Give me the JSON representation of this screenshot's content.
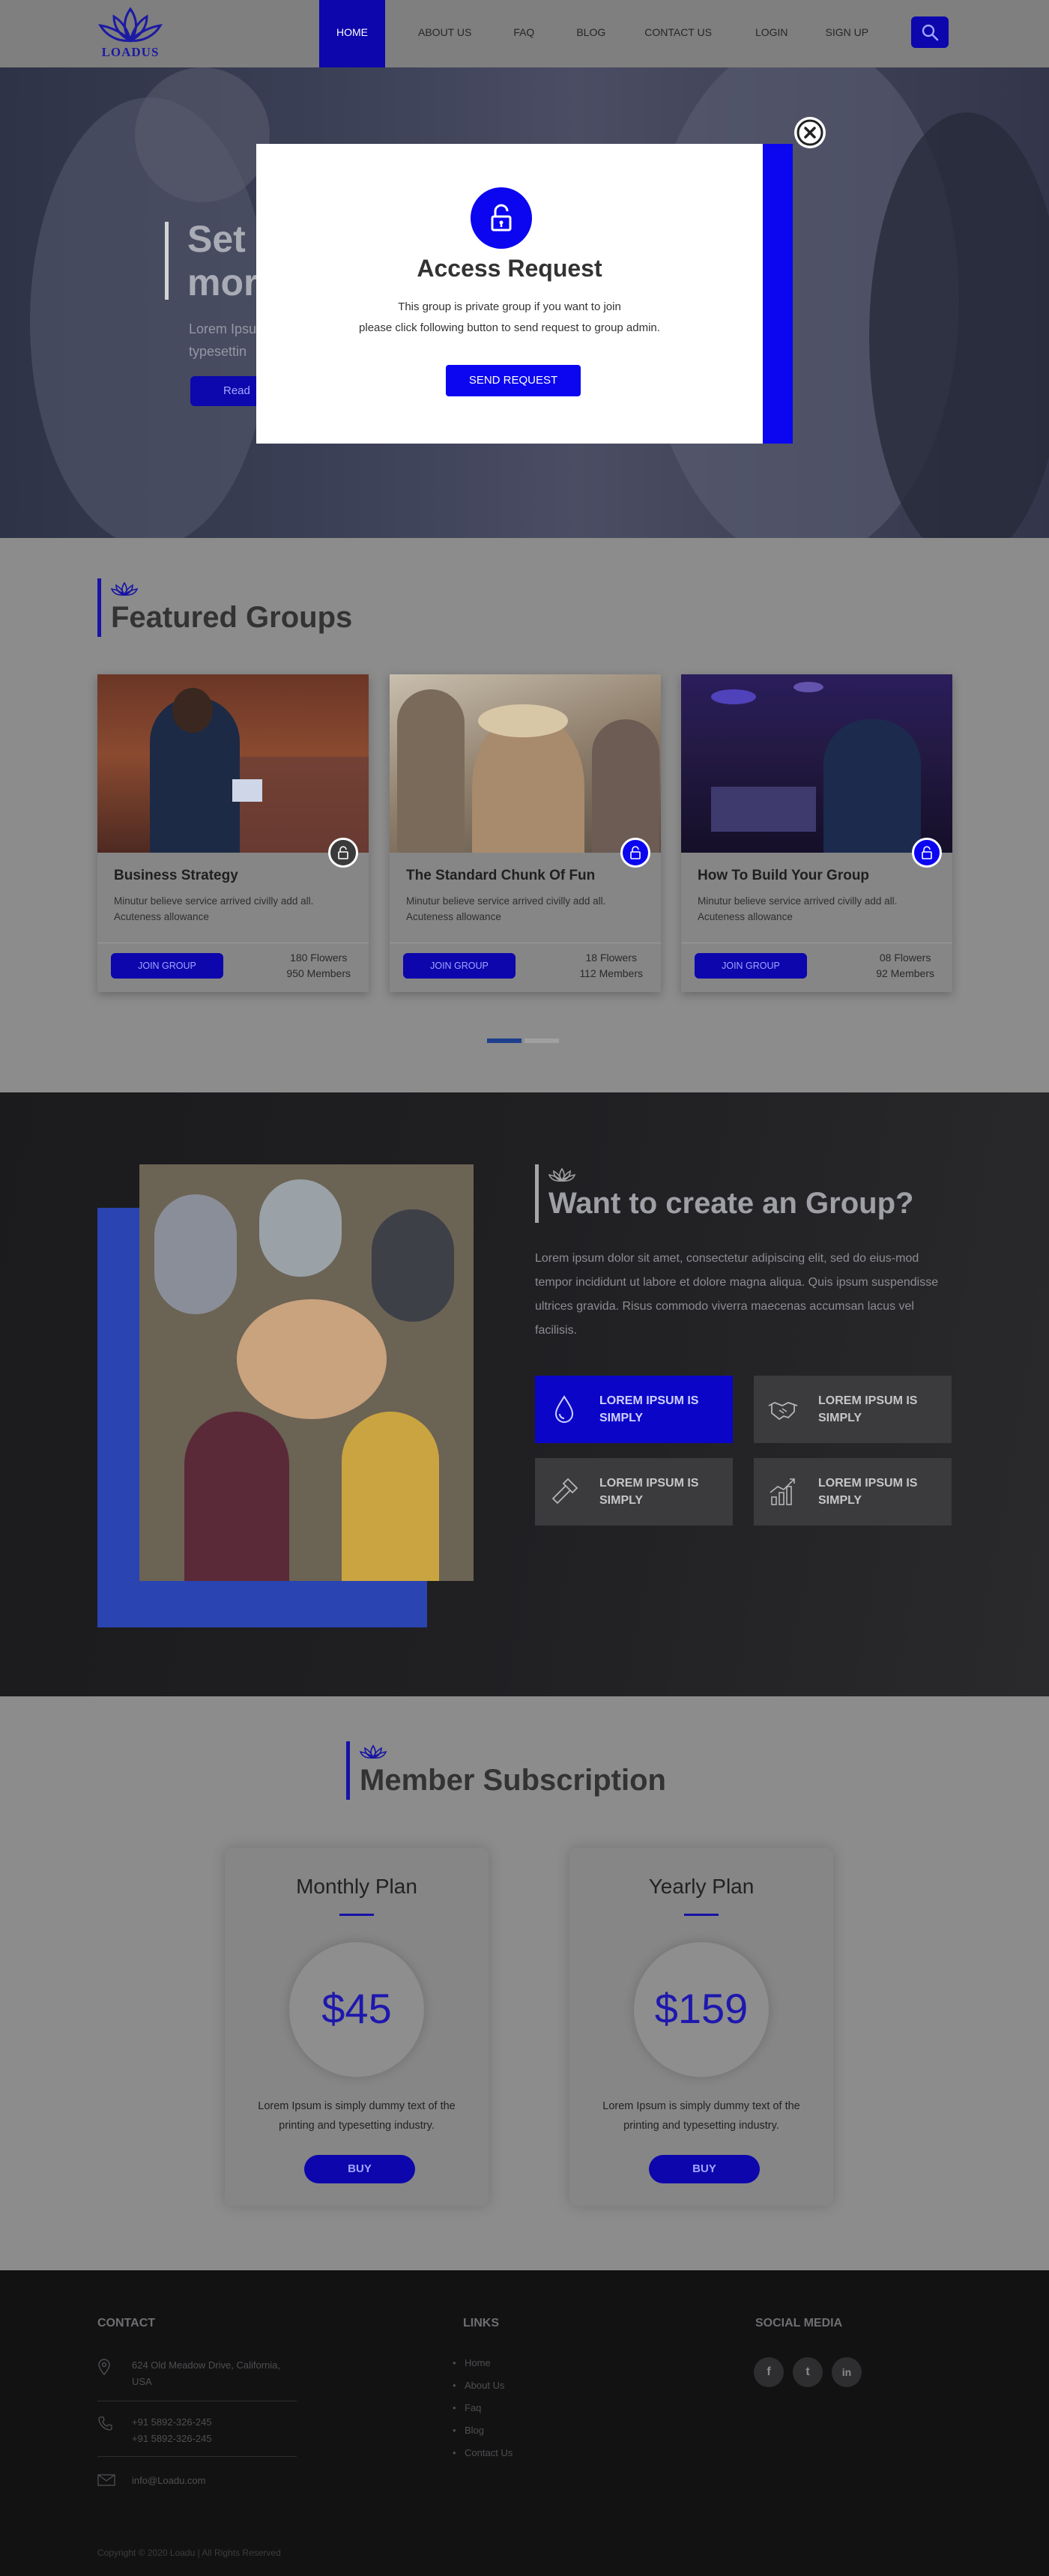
{
  "header": {
    "logo_text": "LOADUS",
    "nav": [
      "HOME",
      "ABOUT US",
      "FAQ",
      "BLOG",
      "CONTACT US",
      "LOGIN",
      "SIGN UP"
    ],
    "active_nav": "HOME",
    "search_icon": "search-icon"
  },
  "hero": {
    "title_line1": "Set",
    "title_line2": "mor",
    "subtitle_line1": "Lorem Ipsu",
    "subtitle_line2": "typesettin",
    "button_label": "Read"
  },
  "modal": {
    "title": "Access Request",
    "text_line1": "This group is private group if you want to join",
    "text_line2": "please click following button to send request to group admin.",
    "button_label": "SEND REQUEST",
    "icon": "unlock-icon",
    "close_icon": "close-icon"
  },
  "featured": {
    "title": "Featured Groups",
    "groups": [
      {
        "title": "Business Strategy",
        "desc": "Minutur believe service arrived civilly add all. Acuteness allowance",
        "button": "JOIN GROUP",
        "stat1": "180 Flowers",
        "stat2": "950 Members"
      },
      {
        "title": "The Standard Chunk Of Fun",
        "desc": "Minutur believe service arrived civilly add all. Acuteness allowance",
        "button": "JOIN GROUP",
        "stat1": "18 Flowers",
        "stat2": "112 Members"
      },
      {
        "title": "How To Build Your Group",
        "desc": "Minutur believe service arrived civilly add all. Acuteness allowance",
        "button": "JOIN GROUP",
        "stat1": "08 Flowers",
        "stat2": "92 Members"
      }
    ]
  },
  "create": {
    "title": "Want to create an Group?",
    "text": "Lorem ipsum dolor sit amet, consectetur adipiscing elit, sed do eius-mod tempor incididunt ut labore et dolore magna aliqua. Quis ipsum suspendisse ultrices gravida. Risus commodo viverra maecenas accumsan lacus vel facilisis.",
    "features": [
      {
        "label": "LOREM IPSUM IS SIMPLY",
        "icon": "water-drop-icon"
      },
      {
        "label": "LOREM IPSUM IS SIMPLY",
        "icon": "handshake-icon"
      },
      {
        "label": "LOREM IPSUM IS SIMPLY",
        "icon": "hammer-icon"
      },
      {
        "label": "LOREM IPSUM IS SIMPLY",
        "icon": "growth-chart-icon"
      }
    ]
  },
  "subscription": {
    "title": "Member Subscription",
    "plans": [
      {
        "name": "Monthly Plan",
        "price": "$45",
        "desc": "Lorem Ipsum is simply dummy text of the printing and typesetting industry.",
        "button": "BUY"
      },
      {
        "name": "Yearly Plan",
        "price": "$159",
        "desc": "Lorem Ipsum is simply dummy text of the printing and typesetting industry.",
        "button": "BUY"
      }
    ]
  },
  "footer": {
    "contact_heading": "CONTACT",
    "address": "624 Old Meadow Drive, California, USA",
    "phone1": "+91 5892-326-245",
    "phone2": "+91 5892-326-245",
    "email": "info@Loadu.com",
    "links_heading": "LINKS",
    "links": [
      "Home",
      "About Us",
      "Faq",
      "Blog",
      "Contact Us"
    ],
    "social_heading": "SOCIAL MEDIA",
    "social": [
      "f",
      "t",
      "in"
    ],
    "copyright": "Copyright © 2020 Loadu | All Rights Reserved"
  },
  "colors": {
    "accent": "#0b05f0",
    "brand_dark": "#0c06ac",
    "overlay": "#8c8c8c"
  }
}
